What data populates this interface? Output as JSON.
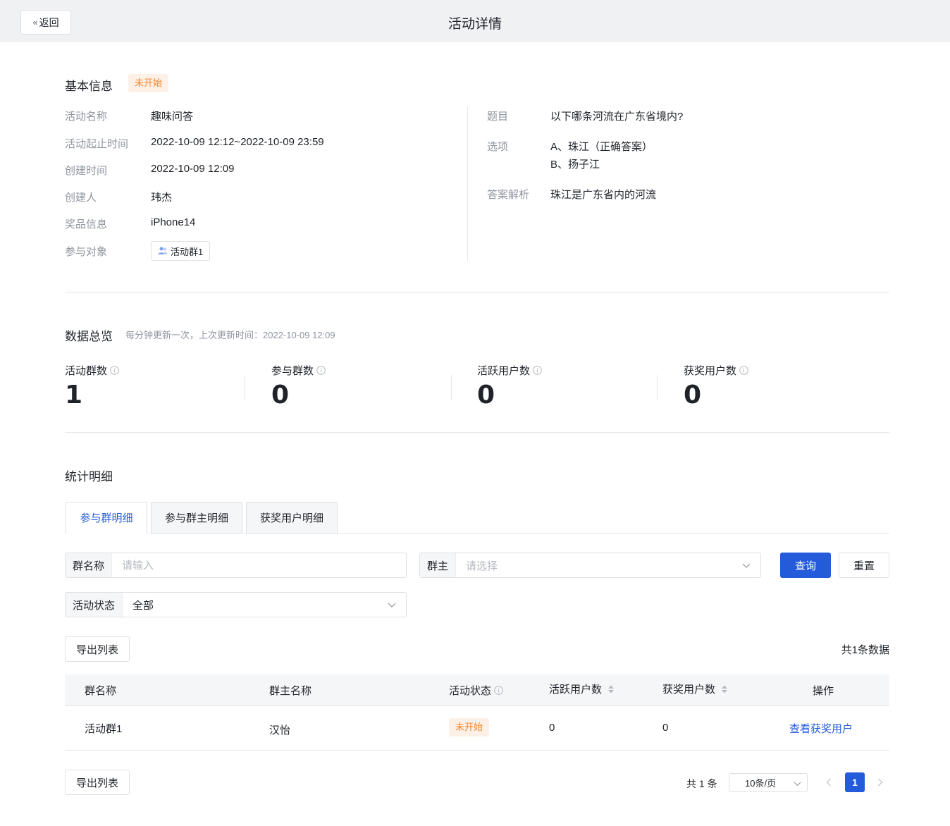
{
  "header": {
    "back_label": "返回",
    "title": "活动详情"
  },
  "basic": {
    "title": "基本信息",
    "status_badge": "未开始",
    "fields": [
      {
        "label": "活动名称",
        "value": "趣味问答"
      },
      {
        "label": "活动起止时间",
        "value": "2022-10-09 12:12~2022-10-09 23:59"
      },
      {
        "label": "创建时间",
        "value": "2022-10-09 12:09"
      },
      {
        "label": "创建人",
        "value": "玮杰"
      },
      {
        "label": "奖品信息",
        "value": "iPhone14"
      },
      {
        "label": "参与对象",
        "value": "活动群1"
      }
    ],
    "question": {
      "label": "题目",
      "value": "以下哪条河流在广东省境内?",
      "options_label": "选项",
      "option_a": "A、珠江（正确答案）",
      "option_b": "B、扬子江",
      "analysis_label": "答案解析",
      "analysis_value": "珠江是广东省内的河流"
    }
  },
  "overview": {
    "title": "数据总览",
    "note": "每分钟更新一次，上次更新时间：2022-10-09 12:09",
    "stats": [
      {
        "label": "活动群数",
        "value": "1"
      },
      {
        "label": "参与群数",
        "value": "0"
      },
      {
        "label": "活跃用户数",
        "value": "0"
      },
      {
        "label": "获奖用户数",
        "value": "0"
      }
    ]
  },
  "detail": {
    "title": "统计明细",
    "tabs": [
      {
        "label": "参与群明细"
      },
      {
        "label": "参与群主明细"
      },
      {
        "label": "获奖用户明细"
      }
    ],
    "filters": {
      "group_name_label": "群名称",
      "group_name_placeholder": "请输入",
      "owner_label": "群主",
      "owner_placeholder": "请选择",
      "status_label": "活动状态",
      "status_value": "全部",
      "query_label": "查询",
      "reset_label": "重置"
    },
    "export_label": "导出列表",
    "total_label": "共1条数据",
    "table": {
      "headers": [
        "群名称",
        "群主名称",
        "活动状态",
        "活跃用户数",
        "获奖用户数",
        "操作"
      ],
      "rows": [
        {
          "group": "活动群1",
          "owner": "汉怡",
          "status": "未开始",
          "active": "0",
          "winners": "0",
          "action": "查看获奖用户"
        }
      ]
    },
    "pagination": {
      "total": "共 1 条",
      "page_size": "10条/页",
      "current_page": "1"
    }
  },
  "colors": {
    "primary": "#245bdb",
    "warning_text": "#f5842b",
    "warning_bg": "#fdf1e7"
  }
}
